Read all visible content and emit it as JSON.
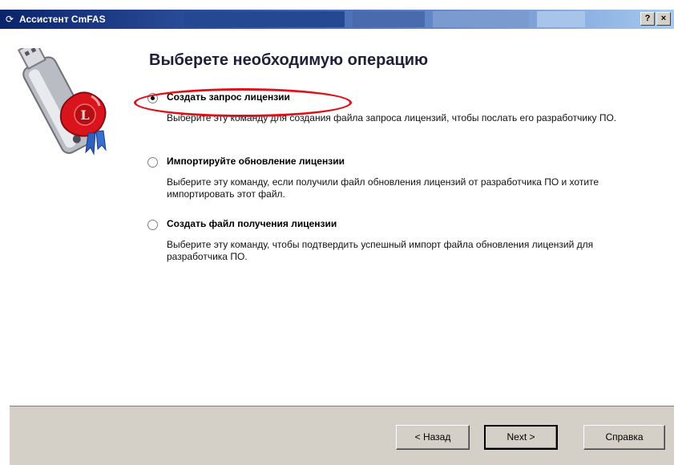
{
  "window": {
    "title": "Ассистент CmFAS",
    "help_button": "?",
    "close_button": "×"
  },
  "heading": "Выберете необходимую операцию",
  "options": [
    {
      "label": "Создать запрос лицензии",
      "description": "Выберите эту команду для создания файла запроса лицензий, чтобы послать его разработчику ПО.",
      "selected": true
    },
    {
      "label": "Импортируйте обновление лицензии",
      "description": "Выберите эту команду, если получили файл обновления лицензий от разработчика ПО и хотите импортировать этот файл.",
      "selected": false
    },
    {
      "label": "Создать файл получения лицензии",
      "description": "Выберите эту команду, чтобы подтвердить успешный импорт файла обновления лицензий для разработчика ПО.",
      "selected": false
    }
  ],
  "footer": {
    "back_label": "< Назад",
    "next_label": "Next >",
    "help_label": "Справка"
  },
  "colors": {
    "title_bar": "#0a246a",
    "highlight": "#e0101a",
    "button_face": "#d4d0c8"
  },
  "icons": {
    "title": "app-icon",
    "wizard": "usb-dongle-with-wax-seal-icon"
  }
}
